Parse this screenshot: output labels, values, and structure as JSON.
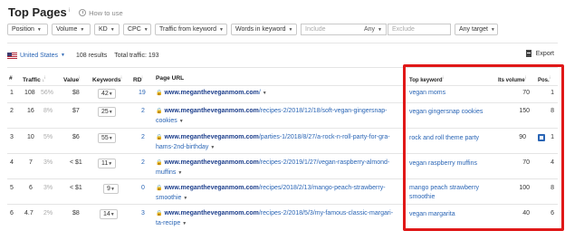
{
  "header": {
    "title": "Top Pages",
    "title_info": "i",
    "how_to": "How to use"
  },
  "filters": [
    {
      "label": "Position"
    },
    {
      "label": "Volume"
    },
    {
      "label": "KD"
    },
    {
      "label": "CPC"
    },
    {
      "label": "Traffic from keyword"
    },
    {
      "label": "Words in keyword"
    }
  ],
  "include": {
    "placeholder": "Include",
    "mode": "Any"
  },
  "exclude": {
    "placeholder": "Exclude"
  },
  "target": {
    "label": "Any target"
  },
  "summary": {
    "country": "United States",
    "results": "108 results",
    "total_traffic": "Total traffic: 193",
    "export": "Export"
  },
  "columns": {
    "num": "#",
    "traffic": "Traffic",
    "value": "Value",
    "keywords": "Keywords",
    "rd": "RD",
    "page_url": "Page URL",
    "top_keyword": "Top keyword",
    "volume": "Its volume",
    "pos": "Pos."
  },
  "rows": [
    {
      "num": "1",
      "traffic": "108",
      "pct": "56%",
      "value": "$8",
      "keywords": "42",
      "rd": "19",
      "domain": "www.megantheveganmom.com",
      "path": "/",
      "top_keyword": "vegan moms",
      "volume": "70",
      "pos": "1"
    },
    {
      "num": "2",
      "traffic": "16",
      "pct": "8%",
      "value": "$7",
      "keywords": "25",
      "rd": "2",
      "domain": "www.megantheveganmom.com",
      "path": "/recipes-2/2018/12/18/soft-vegan-gingersnap-cookies",
      "top_keyword": "vegan gingersnap cookies",
      "volume": "150",
      "pos": "8"
    },
    {
      "num": "3",
      "traffic": "10",
      "pct": "5%",
      "value": "$6",
      "keywords": "55",
      "rd": "2",
      "domain": "www.megantheveganmom.com",
      "path": "/parties-1/2018/8/27/a-rock-n-roll-party-for-gra-hams-2nd-birthday",
      "top_keyword": "rock and roll theme party",
      "volume": "90",
      "pos": "1"
    },
    {
      "num": "4",
      "traffic": "7",
      "pct": "3%",
      "value": "< $1",
      "keywords": "11",
      "rd": "2",
      "domain": "www.megantheveganmom.com",
      "path": "/recipes-2/2019/1/27/vegan-raspberry-almond-muffins",
      "top_keyword": "vegan raspberry muffins",
      "volume": "70",
      "pos": "4"
    },
    {
      "num": "5",
      "traffic": "6",
      "pct": "3%",
      "value": "< $1",
      "keywords": "9",
      "rd": "0",
      "domain": "www.megantheveganmom.com",
      "path": "/recipes/2018/2/13/mango-peach-strawberry-smoothie",
      "top_keyword": "mango peach strawberry smoothie",
      "volume": "100",
      "pos": "8"
    },
    {
      "num": "6",
      "traffic": "4.7",
      "pct": "2%",
      "value": "$8",
      "keywords": "14",
      "rd": "3",
      "domain": "www.megantheveganmom.com",
      "path": "/recipes-2/2018/5/3/my-famous-classic-margari-ta-recipe",
      "top_keyword": "vegan margarita",
      "volume": "40",
      "pos": "6"
    }
  ],
  "colors": {
    "accent": "#2a65b5",
    "highlight": "#e01818"
  }
}
